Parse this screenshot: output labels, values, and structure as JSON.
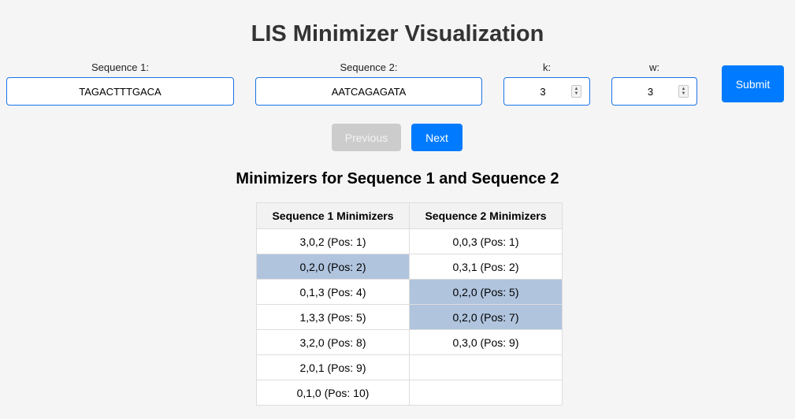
{
  "title": "LIS Minimizer Visualization",
  "form": {
    "seq1_label": "Sequence 1:",
    "seq1_value": "TAGACTTTGACA",
    "seq2_label": "Sequence 2:",
    "seq2_value": "AATCAGAGATA",
    "k_label": "k:",
    "k_value": "3",
    "w_label": "w:",
    "w_value": "3",
    "submit_label": "Submit"
  },
  "nav": {
    "previous_label": "Previous",
    "next_label": "Next",
    "previous_disabled": true
  },
  "section_title": "Minimizers for Sequence 1 and Sequence 2",
  "table": {
    "headers": [
      "Sequence 1 Minimizers",
      "Sequence 2 Minimizers"
    ],
    "highlight_color": "#b0c4de",
    "rows": [
      {
        "seq1": "3,0,2 (Pos: 1)",
        "seq1_highlight": false,
        "seq2": "0,0,3 (Pos: 1)",
        "seq2_highlight": false
      },
      {
        "seq1": "0,2,0 (Pos: 2)",
        "seq1_highlight": true,
        "seq2": "0,3,1 (Pos: 2)",
        "seq2_highlight": false
      },
      {
        "seq1": "0,1,3 (Pos: 4)",
        "seq1_highlight": false,
        "seq2": "0,2,0 (Pos: 5)",
        "seq2_highlight": true
      },
      {
        "seq1": "1,3,3 (Pos: 5)",
        "seq1_highlight": false,
        "seq2": "0,2,0 (Pos: 7)",
        "seq2_highlight": true
      },
      {
        "seq1": "3,2,0 (Pos: 8)",
        "seq1_highlight": false,
        "seq2": "0,3,0 (Pos: 9)",
        "seq2_highlight": false
      },
      {
        "seq1": "2,0,1 (Pos: 9)",
        "seq1_highlight": false,
        "seq2": "",
        "seq2_highlight": false
      },
      {
        "seq1": "0,1,0 (Pos: 10)",
        "seq1_highlight": false,
        "seq2": "",
        "seq2_highlight": false
      }
    ]
  }
}
